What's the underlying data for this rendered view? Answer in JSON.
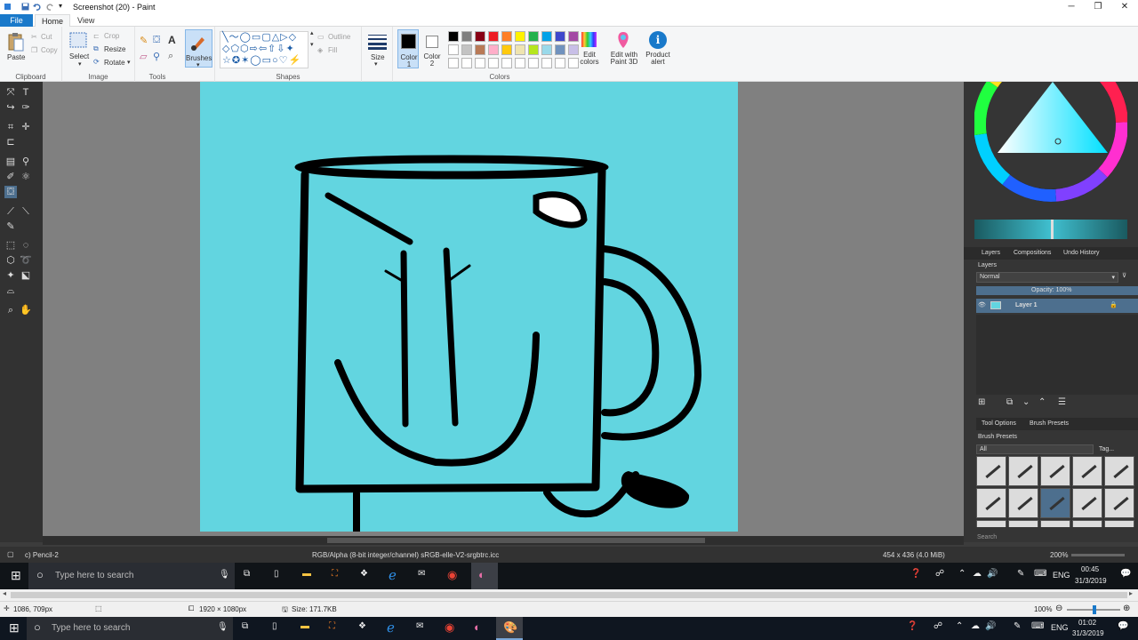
{
  "window": {
    "title": "Screenshot (20) - Paint"
  },
  "ribbon_tabs": {
    "file": "File",
    "home": "Home",
    "view": "View"
  },
  "clipboard": {
    "paste": "Paste",
    "cut": "Cut",
    "copy": "Copy",
    "label": "Clipboard"
  },
  "image": {
    "select": "Select",
    "crop": "Crop",
    "resize": "Resize",
    "rotate": "Rotate",
    "label": "Image"
  },
  "tools": {
    "label": "Tools",
    "brushes": "Brushes"
  },
  "shapes": {
    "outline": "Outline",
    "fill": "Fill",
    "label": "Shapes"
  },
  "size": {
    "label": "Size"
  },
  "colors": {
    "color1": "Color 1",
    "color2": "Color 2",
    "label": "Colors",
    "edit_colors": "Edit colors",
    "edit_3d": "Edit with Paint 3D",
    "product_alert": "Product alert",
    "palette_row1": [
      "#000000",
      "#7f7f7f",
      "#880015",
      "#ed1c24",
      "#ff7f27",
      "#fff200",
      "#22b14c",
      "#00a2e8",
      "#3f48cc",
      "#a349a4"
    ],
    "palette_row2": [
      "#ffffff",
      "#c3c3c3",
      "#b97a57",
      "#ffaec9",
      "#ffc90e",
      "#efe4b0",
      "#b5e61d",
      "#99d9ea",
      "#7092be",
      "#c8bfe7"
    ]
  },
  "drawing": {
    "background": "#62d5e0"
  },
  "docker": {
    "tabs": [
      "Layers",
      "Compositions",
      "Undo History"
    ],
    "layers_title": "Layers",
    "blend_mode": "Normal",
    "opacity": "Opacity:  100%",
    "layer_name": "Layer 1",
    "bottom_tabs": [
      "Tool Options",
      "Brush Presets"
    ],
    "brush_presets": "Brush Presets",
    "filter": "All",
    "tag": "Tag...",
    "search": "Search"
  },
  "krita_status": {
    "brush": "c) Pencil-2",
    "color_space": "RGB/Alpha (8-bit integer/channel)  sRGB-elle-V2-srgbtrc.icc",
    "image_size": "454 x 436 (4.0 MiB)",
    "zoom": "200%"
  },
  "taskbar_inner": {
    "search": "Type here to search",
    "lang": "ENG",
    "time": "00:45",
    "date": "31/3/2019"
  },
  "paint_status": {
    "cursor": "1086, 709px",
    "dimensions": "1920 × 1080px",
    "size": "Size: 171.7KB",
    "zoom": "100%"
  },
  "taskbar": {
    "search": "Type here to search",
    "lang": "ENG",
    "time": "01:02",
    "date": "31/3/2019"
  }
}
